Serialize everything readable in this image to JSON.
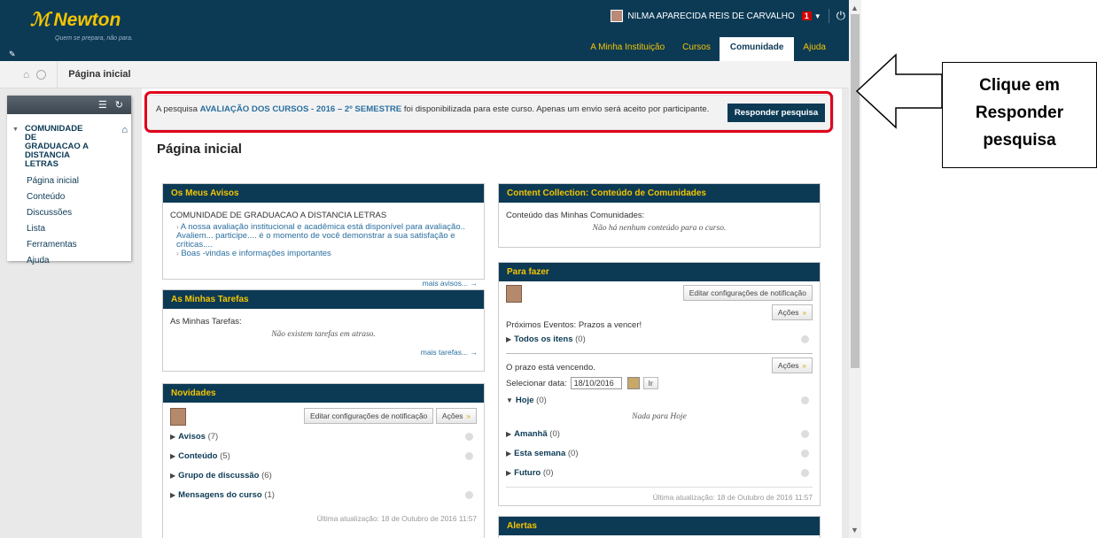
{
  "brand": {
    "logo_mark": "ℳ",
    "name": "Newton",
    "tagline": "Quem se prepara, não para."
  },
  "user": {
    "name": "NILMA APARECIDA REIS DE CARVALHO",
    "notifications": "1"
  },
  "topnav": {
    "tabs": [
      "A Minha Instituição",
      "Cursos",
      "Comunidade",
      "Ajuda"
    ],
    "active": "Comunidade"
  },
  "breadcrumb": {
    "current": "Página inicial"
  },
  "sidebar": {
    "course_name": "COMUNIDADE DE GRADUACAO A DISTANCIA LETRAS",
    "items": [
      "Página inicial",
      "Conteúdo",
      "Discussões",
      "Lista",
      "Ferramentas",
      "Ajuda"
    ]
  },
  "notice": {
    "prefix": "A pesquisa",
    "survey_name": "AVALIAÇÃO DOS CURSOS - 2016 – 2º SEMESTRE",
    "suffix": "foi disponibilizada para este curso. Apenas um envio será aceito por participante.",
    "button": "Responder pesquisa"
  },
  "page_title": "Página inicial",
  "avisos": {
    "title": "Os Meus Avisos",
    "course": "COMUNIDADE DE GRADUACAO A DISTANCIA LETRAS",
    "items": [
      "A nossa avaliação institucional e acadêmica está disponível para avaliação.. Avaliem... participe.... é o momento de você demonstrar a sua satisfação e críticas....",
      "Boas -vindas e informações importantes"
    ],
    "more": "mais avisos..."
  },
  "tarefas": {
    "title": "As Minhas Tarefas",
    "label": "As Minhas Tarefas:",
    "empty": "Não existem tarefas em atraso.",
    "more": "mais tarefas..."
  },
  "novidades": {
    "title": "Novidades",
    "edit_button": "Editar configurações de notificação",
    "actions": "Ações",
    "rows": [
      {
        "label": "Avisos",
        "count": "(7)"
      },
      {
        "label": "Conteúdo",
        "count": "(5)"
      },
      {
        "label": "Grupo de discussão",
        "count": "(6)"
      },
      {
        "label": "Mensagens do curso",
        "count": "(1)"
      }
    ],
    "updated": "Última atualização: 18 de Outubro de 2016 11:57"
  },
  "content_collection": {
    "title": "Content Collection: Conteúdo de Comunidades",
    "label": "Conteúdo das Minhas Comunidades:",
    "empty": "Não há nenhum conteúdo para o curso."
  },
  "para_fazer": {
    "title": "Para fazer",
    "edit_button": "Editar configurações de notificação",
    "actions": "Ações",
    "upcoming_label": "Próximos Eventos: Prazos a vencer!",
    "all_items": {
      "label": "Todos os itens",
      "count": "(0)"
    },
    "due_label": "O prazo está vencendo.",
    "date_label": "Selecionar data:",
    "date_value": "18/10/2016",
    "go_button": "Ir",
    "today": {
      "label": "Hoje",
      "count": "(0)"
    },
    "today_empty": "Nada para Hoje",
    "rows": [
      {
        "label": "Amanhã",
        "count": "(0)"
      },
      {
        "label": "Esta semana",
        "count": "(0)"
      },
      {
        "label": "Futuro",
        "count": "(0)"
      }
    ],
    "updated": "Última atualização: 18 de Outubro de 2016 11:57"
  },
  "alertas": {
    "title": "Alertas"
  },
  "callout": {
    "line1": "Clique em",
    "line2": "Responder",
    "line3": "pesquisa"
  },
  "colors": {
    "navy": "#0c3a55",
    "gold": "#f5c400",
    "highlight_red": "#e0001b"
  }
}
